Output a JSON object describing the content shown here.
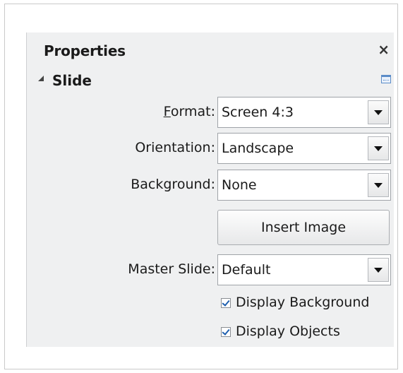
{
  "panel": {
    "title": "Properties",
    "close_glyph": "×"
  },
  "section": {
    "title": "Slide"
  },
  "fields": {
    "format": {
      "label_prefix": "",
      "mnemonic": "F",
      "label_rest": "ormat:",
      "value": "Screen 4:3"
    },
    "orientation": {
      "label": "Orientation:",
      "value": "Landscape"
    },
    "background": {
      "label": "Background:",
      "value": "None"
    },
    "master_slide": {
      "label": "Master Slide:",
      "value": "Default"
    }
  },
  "insert_image": {
    "label": "Insert Image"
  },
  "checkboxes": {
    "display_background": {
      "label": "Display Background",
      "checked": true
    },
    "display_objects": {
      "label": "Display Objects",
      "checked": true
    }
  },
  "icons": {
    "collapse": "triangle-down-right-icon",
    "more_options": "more-options-icon",
    "combo_arrow": "chevron-down-icon"
  },
  "colors": {
    "panel_bg": "#eff0f1",
    "check_mark": "#1e5fae"
  }
}
